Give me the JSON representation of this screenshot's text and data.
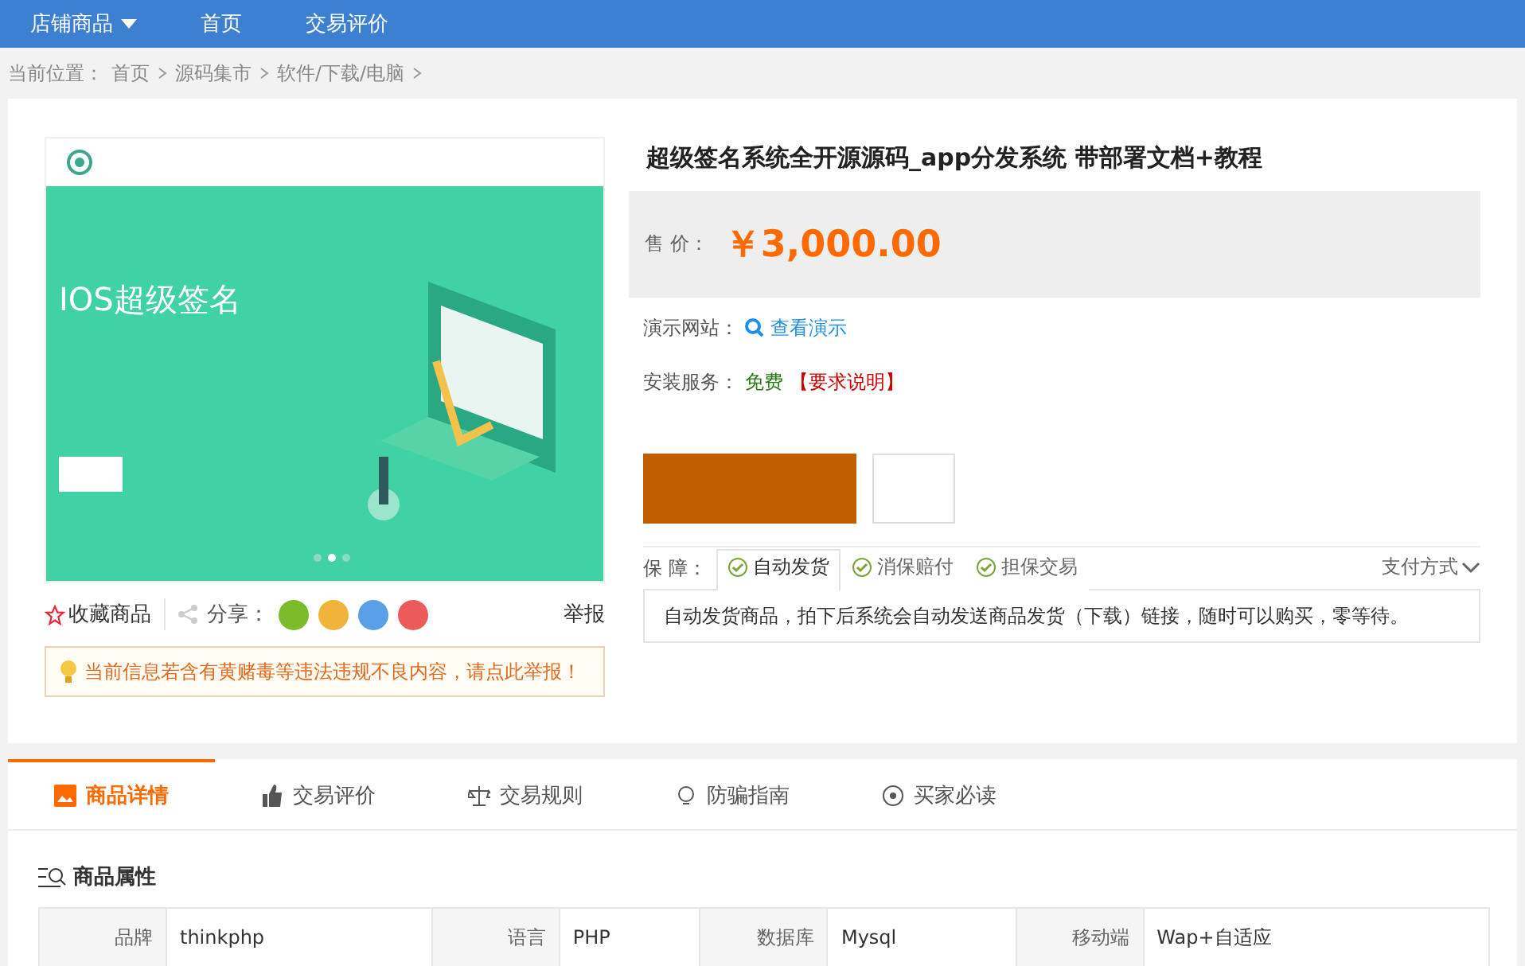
{
  "top_nav": [
    {
      "label": "店铺商品",
      "dropdown": true
    },
    {
      "label": "首页",
      "dropdown": false
    },
    {
      "label": "交易评价",
      "dropdown": false
    }
  ],
  "breadcrumb": {
    "prefix": "当前位置：",
    "items": [
      "首页",
      "源码集市",
      "软件/下载/电脑"
    ]
  },
  "gallery": {
    "heading": "IOS超级签名",
    "dots": [
      {
        "selected": false
      },
      {
        "selected": true
      },
      {
        "selected": false
      }
    ]
  },
  "actions": {
    "favorite": "收藏商品",
    "share_label": "分享：",
    "report": "举报"
  },
  "notice": "当前信息若含有黄赌毒等违法违规不良内容，请点此举报！",
  "product": {
    "title": "超级签名系统全开源源码_app分发系统 带部署文档+教程",
    "price_label": "售 价：",
    "price": "￥3,000.00",
    "demo_label": "演示网站：",
    "demo_link": "查看演示",
    "install_label": "安装服务：",
    "install_value": "免费",
    "install_note": "【要求说明】"
  },
  "guarantee": {
    "label": "保 障：",
    "items": [
      {
        "label": "自动发货",
        "selected": true
      },
      {
        "label": "消保赔付",
        "selected": false
      },
      {
        "label": "担保交易",
        "selected": false
      }
    ],
    "payment": "支付方式",
    "description": "自动发货商品，拍下后系统会自动发送商品发货（下载）链接，随时可以购买，零等待。"
  },
  "detail_tabs": [
    {
      "label": "商品详情",
      "selected": true
    },
    {
      "label": "交易评价",
      "selected": false
    },
    {
      "label": "交易规则",
      "selected": false
    },
    {
      "label": "防骗指南",
      "selected": false
    },
    {
      "label": "买家必读",
      "selected": false
    }
  ],
  "attributes": {
    "title": "商品属性",
    "rows": [
      [
        {
          "name": "品牌",
          "value": "thinkphp"
        },
        {
          "name": "语言",
          "value": "PHP"
        },
        {
          "name": "数据库",
          "value": "Mysql"
        },
        {
          "name": "移动端",
          "value": "Wap+自适应"
        }
      ]
    ]
  }
}
